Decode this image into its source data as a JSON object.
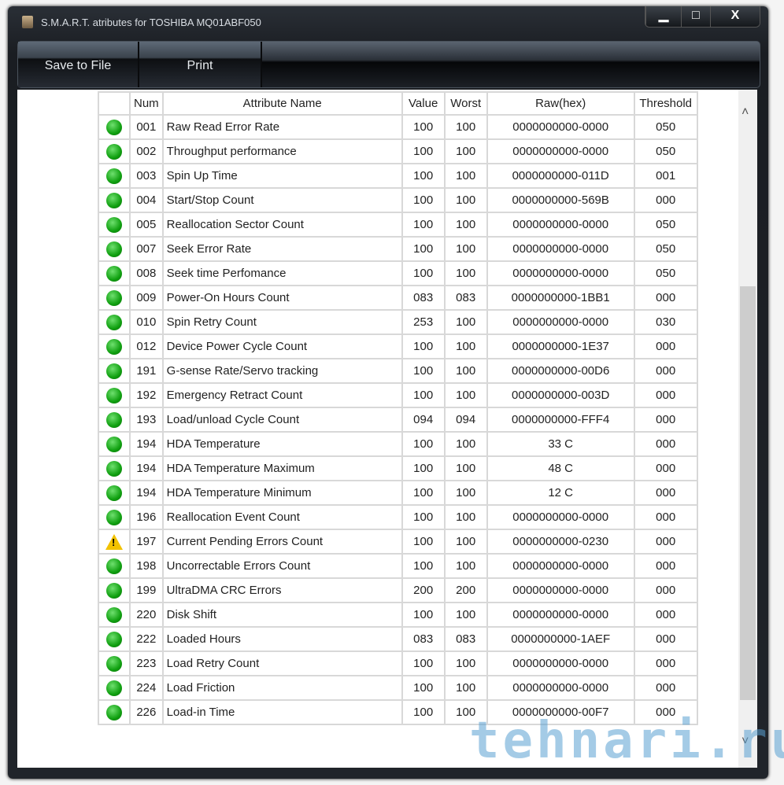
{
  "window": {
    "title": "S.M.A.R.T. atributes for TOSHIBA MQ01ABF050",
    "minimize": "▁",
    "maximize": "□",
    "close": "X"
  },
  "toolbar": {
    "save": "Save to File",
    "print": "Print"
  },
  "table": {
    "headers": [
      "",
      "Num",
      "Attribute Name",
      "Value",
      "Worst",
      "Raw(hex)",
      "Threshold"
    ],
    "rows": [
      {
        "status": "ok",
        "num": "001",
        "name": "Raw Read Error Rate",
        "value": "100",
        "worst": "100",
        "raw": "0000000000-0000",
        "threshold": "050"
      },
      {
        "status": "ok",
        "num": "002",
        "name": "Throughput performance",
        "value": "100",
        "worst": "100",
        "raw": "0000000000-0000",
        "threshold": "050"
      },
      {
        "status": "ok",
        "num": "003",
        "name": "Spin Up Time",
        "value": "100",
        "worst": "100",
        "raw": "0000000000-011D",
        "threshold": "001"
      },
      {
        "status": "ok",
        "num": "004",
        "name": "Start/Stop Count",
        "value": "100",
        "worst": "100",
        "raw": "0000000000-569B",
        "threshold": "000"
      },
      {
        "status": "ok",
        "num": "005",
        "name": "Reallocation Sector Count",
        "value": "100",
        "worst": "100",
        "raw": "0000000000-0000",
        "threshold": "050"
      },
      {
        "status": "ok",
        "num": "007",
        "name": "Seek Error Rate",
        "value": "100",
        "worst": "100",
        "raw": "0000000000-0000",
        "threshold": "050"
      },
      {
        "status": "ok",
        "num": "008",
        "name": "Seek time Perfomance",
        "value": "100",
        "worst": "100",
        "raw": "0000000000-0000",
        "threshold": "050"
      },
      {
        "status": "ok",
        "num": "009",
        "name": "Power-On Hours Count",
        "value": "083",
        "worst": "083",
        "raw": "0000000000-1BB1",
        "threshold": "000"
      },
      {
        "status": "ok",
        "num": "010",
        "name": "Spin Retry Count",
        "value": "253",
        "worst": "100",
        "raw": "0000000000-0000",
        "threshold": "030"
      },
      {
        "status": "ok",
        "num": "012",
        "name": "Device Power Cycle Count",
        "value": "100",
        "worst": "100",
        "raw": "0000000000-1E37",
        "threshold": "000"
      },
      {
        "status": "ok",
        "num": "191",
        "name": "G-sense Rate/Servo tracking",
        "value": "100",
        "worst": "100",
        "raw": "0000000000-00D6",
        "threshold": "000"
      },
      {
        "status": "ok",
        "num": "192",
        "name": "Emergency Retract Count",
        "value": "100",
        "worst": "100",
        "raw": "0000000000-003D",
        "threshold": "000"
      },
      {
        "status": "ok",
        "num": "193",
        "name": "Load/unload Cycle Count",
        "value": "094",
        "worst": "094",
        "raw": "0000000000-FFF4",
        "threshold": "000"
      },
      {
        "status": "ok",
        "num": "194",
        "name": "HDA Temperature",
        "value": "100",
        "worst": "100",
        "raw": "33 C",
        "threshold": "000"
      },
      {
        "status": "ok",
        "num": "194",
        "name": "HDA Temperature Maximum",
        "value": "100",
        "worst": "100",
        "raw": "48 C",
        "threshold": "000"
      },
      {
        "status": "ok",
        "num": "194",
        "name": "HDA Temperature Minimum",
        "value": "100",
        "worst": "100",
        "raw": "12 C",
        "threshold": "000"
      },
      {
        "status": "ok",
        "num": "196",
        "name": "Reallocation Event Count",
        "value": "100",
        "worst": "100",
        "raw": "0000000000-0000",
        "threshold": "000"
      },
      {
        "status": "warning",
        "num": "197",
        "name": "Current Pending Errors Count",
        "value": "100",
        "worst": "100",
        "raw": "0000000000-0230",
        "threshold": "000"
      },
      {
        "status": "ok",
        "num": "198",
        "name": "Uncorrectable Errors Count",
        "value": "100",
        "worst": "100",
        "raw": "0000000000-0000",
        "threshold": "000"
      },
      {
        "status": "ok",
        "num": "199",
        "name": "UltraDMA CRC Errors",
        "value": "200",
        "worst": "200",
        "raw": "0000000000-0000",
        "threshold": "000"
      },
      {
        "status": "ok",
        "num": "220",
        "name": "Disk Shift",
        "value": "100",
        "worst": "100",
        "raw": "0000000000-0000",
        "threshold": "000"
      },
      {
        "status": "ok",
        "num": "222",
        "name": "Loaded Hours",
        "value": "083",
        "worst": "083",
        "raw": "0000000000-1AEF",
        "threshold": "000"
      },
      {
        "status": "ok",
        "num": "223",
        "name": "Load Retry Count",
        "value": "100",
        "worst": "100",
        "raw": "0000000000-0000",
        "threshold": "000"
      },
      {
        "status": "ok",
        "num": "224",
        "name": "Load Friction",
        "value": "100",
        "worst": "100",
        "raw": "0000000000-0000",
        "threshold": "000"
      },
      {
        "status": "ok",
        "num": "226",
        "name": "Load-in Time",
        "value": "100",
        "worst": "100",
        "raw": "0000000000-00F7",
        "threshold": "000"
      }
    ]
  },
  "watermark": "tehnari.ru"
}
